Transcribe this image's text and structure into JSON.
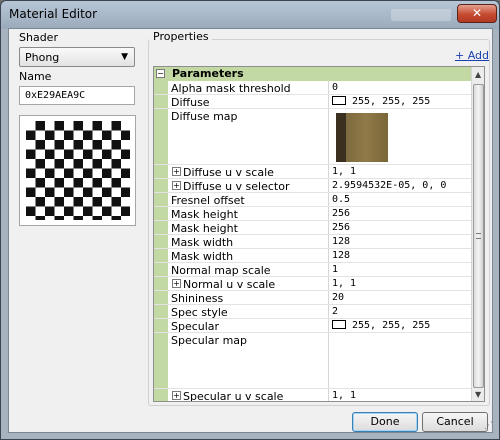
{
  "window": {
    "title": "Material Editor",
    "close_glyph": "✕"
  },
  "shader": {
    "label": "Shader",
    "value": "Phong"
  },
  "name": {
    "label": "Name",
    "value": "0xE29AEA9C"
  },
  "properties": {
    "label": "Properties",
    "add_link": "+ Add",
    "category": "Parameters",
    "rows": [
      {
        "name": "Alpha mask threshold",
        "value": "0"
      },
      {
        "name": "Diffuse",
        "value": "255, 255, 255"
      },
      {
        "name": "Diffuse map",
        "value": ""
      },
      {
        "name": "Diffuse u v scale",
        "value": "1, 1"
      },
      {
        "name": "Diffuse u v selector",
        "value": "2.9594532E-05, 0, 0"
      },
      {
        "name": "Fresnel offset",
        "value": "0.5"
      },
      {
        "name": "Mask height",
        "value": "256"
      },
      {
        "name": "Mask height",
        "value": "256"
      },
      {
        "name": "Mask width",
        "value": "128"
      },
      {
        "name": "Mask width",
        "value": "128"
      },
      {
        "name": "Normal map scale",
        "value": "1"
      },
      {
        "name": "Normal u v scale",
        "value": "1, 1"
      },
      {
        "name": "Shininess",
        "value": "20"
      },
      {
        "name": "Spec style",
        "value": "2"
      },
      {
        "name": "Specular",
        "value": "255, 255, 255"
      },
      {
        "name": "Specular map",
        "value": ""
      },
      {
        "name": "Specular u v scale",
        "value": "1, 1"
      }
    ]
  },
  "buttons": {
    "done": "Done",
    "cancel": "Cancel"
  },
  "colors": {
    "category_bg": "#c2d9a3",
    "link": "#1a3fb0",
    "title_close": "#c44b30"
  }
}
